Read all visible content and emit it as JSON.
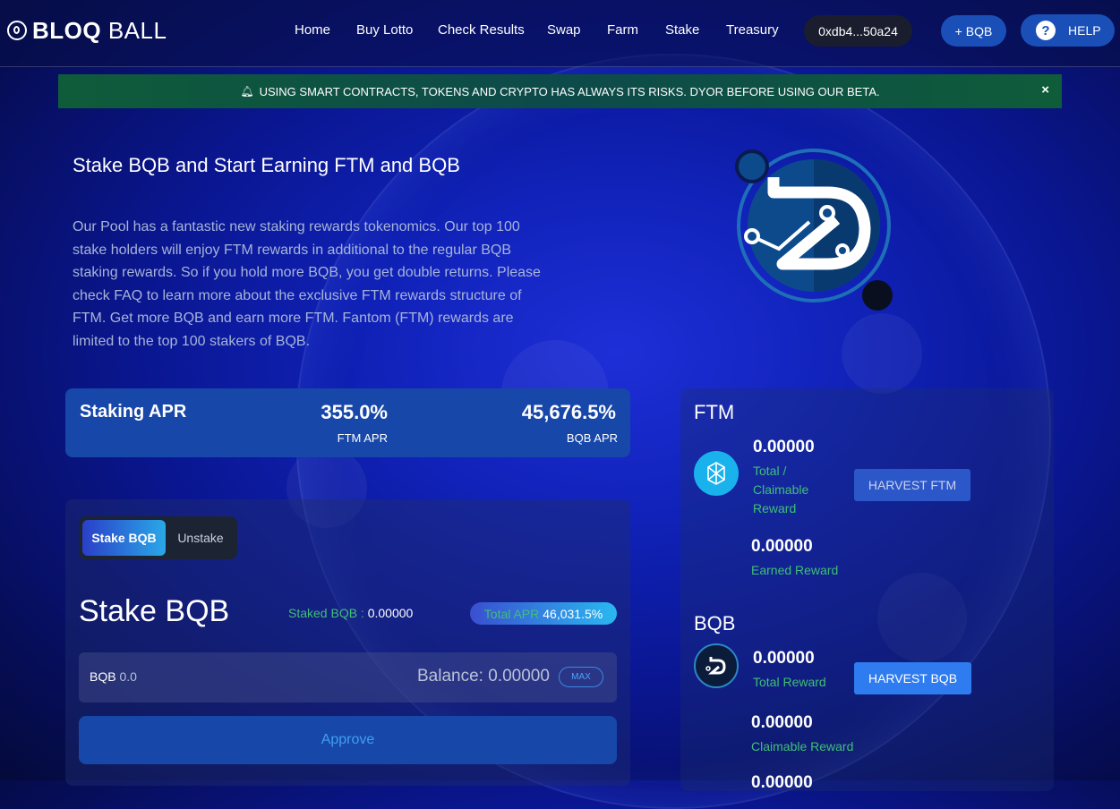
{
  "nav": {
    "logo_bold": "BLOQ",
    "logo_thin": " BALL",
    "links": [
      "Home",
      "Buy Lotto",
      "Check Results",
      "Swap",
      "Farm",
      "Stake",
      "Treasury"
    ],
    "wallet": "0xdb4...50a24",
    "add_bqb": "+ BQB",
    "help": "HELP"
  },
  "alert": {
    "text": "USING SMART CONTRACTS, TOKENS AND CRYPTO HAS ALWAYS ITS RISKS. DYOR BEFORE USING OUR BETA.",
    "close": "×"
  },
  "intro": {
    "title": "Stake BQB and Start Earning FTM and BQB",
    "text": "Our Pool has a fantastic new staking rewards tokenomics. Our top 100 stake holders will enjoy FTM rewards in additional to the regular BQB staking rewards. So if you hold more BQB, you get double returns. Please check FAQ to learn more about the exclusive FTM rewards structure of FTM. Get more BQB and earn more FTM. Fantom (FTM) rewards are limited to the top 100 stakers of BQB."
  },
  "apr": {
    "label": "Staking APR",
    "ftm_value": "355.0%",
    "ftm_label": "FTM APR",
    "bqb_value": "45,676.5%",
    "bqb_label": "BQB APR"
  },
  "stake": {
    "tab_stake": "Stake BQB",
    "tab_unstake": "Unstake",
    "title": "Stake BQB",
    "staked_label": "Staked BQB : ",
    "staked_value": "0.00000",
    "total_apr_label": "Total APR",
    "total_apr_value": "46,031.5%",
    "input_token": "BQB",
    "input_value": "0.0",
    "balance": "Balance: 0.00000",
    "max": "MAX",
    "approve": "Approve"
  },
  "rewards": {
    "ftm": {
      "title": "FTM",
      "total_amount": "0.00000",
      "total_label": "Total / Claimable Reward",
      "harvest": "HARVEST FTM",
      "earned_amount": "0.00000",
      "earned_label": "Earned Reward"
    },
    "bqb": {
      "title": "BQB",
      "total_amount": "0.00000",
      "total_label": "Total Reward",
      "harvest": "HARVEST BQB",
      "claimable_amount": "0.00000",
      "claimable_label": "Claimable Reward",
      "extra_amount": "0.00000"
    }
  },
  "colors": {
    "accent_blue": "#1747a8",
    "green_label": "#3fbf76",
    "alert_green": "#0f5c3a"
  }
}
